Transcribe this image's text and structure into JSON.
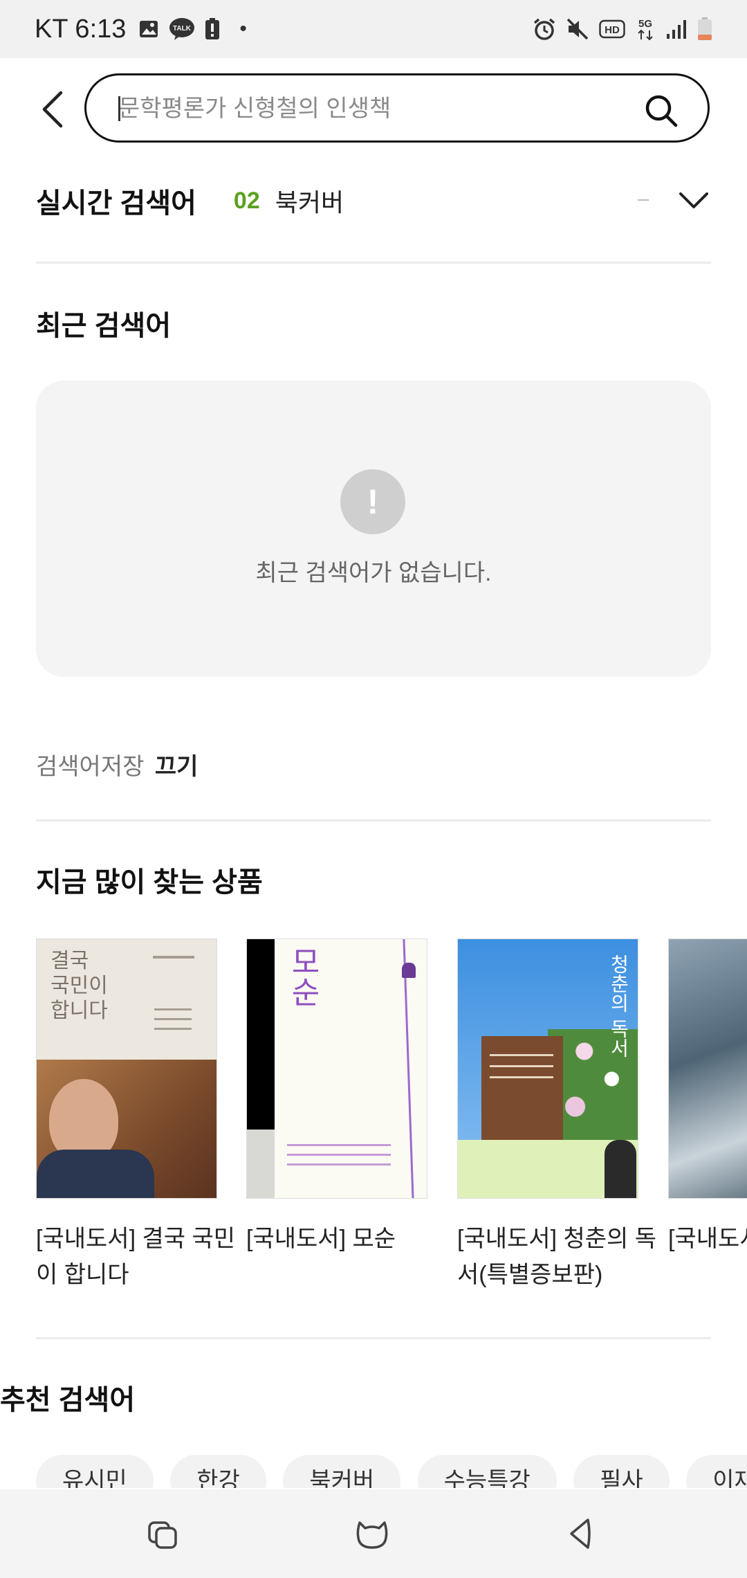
{
  "status_bar": {
    "carrier_time": "KT 6:13",
    "dot": "•"
  },
  "search": {
    "placeholder": "문학평론가 신형철의 인생책"
  },
  "realtime": {
    "title": "실시간 검색어",
    "rank": "02",
    "keyword": "북커버"
  },
  "recent": {
    "title": "최근 검색어",
    "empty_icon_glyph": "!",
    "empty_message": "최근 검색어가 없습니다."
  },
  "save_setting": {
    "label": "검색어저장",
    "state": "끄기"
  },
  "popular": {
    "title": "지금 많이 찾는 상품",
    "items": [
      {
        "title": "[국내도서] 결국 국민이 합니다",
        "cover_text": "결국\n국민이\n합니다"
      },
      {
        "title": "[국내도서] 모순",
        "cover_text": "모순"
      },
      {
        "title": "[국내도서] 청춘의 독서(특별증보판)",
        "cover_text": "청춘의 독서"
      },
      {
        "title": "[국내도서]"
      }
    ]
  },
  "recommended": {
    "title": "추천 검색어",
    "chips": [
      "유시민",
      "한강",
      "북커버",
      "수능특강",
      "필사",
      "이재"
    ]
  },
  "colors": {
    "rank_green": "#5aa11f",
    "empty_bg": "#f4f4f4",
    "divider": "#ebebeb"
  }
}
